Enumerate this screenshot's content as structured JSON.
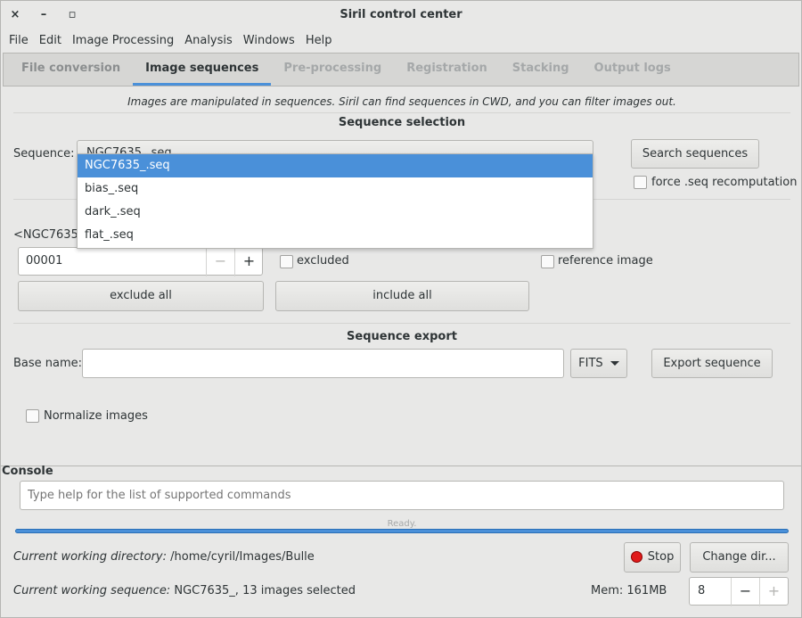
{
  "window": {
    "title": "Siril control center",
    "close_glyph": "×",
    "minimize_glyph": "–",
    "maximize_glyph": "▫"
  },
  "menu": [
    "File",
    "Edit",
    "Image Processing",
    "Analysis",
    "Windows",
    "Help"
  ],
  "tabs": [
    {
      "label": "File conversion",
      "state": "normal"
    },
    {
      "label": "Image sequences",
      "state": "active"
    },
    {
      "label": "Pre-processing",
      "state": "faded"
    },
    {
      "label": "Registration",
      "state": "faded"
    },
    {
      "label": "Stacking",
      "state": "faded"
    },
    {
      "label": "Output logs",
      "state": "faded"
    }
  ],
  "sequences_panel": {
    "info_text": "Images are manipulated in sequences. Siril can find sequences in CWD, and you can filter images out.",
    "selection_title": "Sequence selection",
    "sequence_label": "Sequence:",
    "sequence_value_partial": "NGC7635_.seq",
    "search_button": "Search sequences",
    "force_recompute_label": "force .seq recomputation",
    "dropdown_options": [
      "NGC7635_.seq",
      "bias_.seq",
      "dark_.seq",
      "flat_.seq"
    ],
    "selected_option_index": 0,
    "image_label_partial": "<NGC7635_",
    "image_number": "00001",
    "minus_glyph": "−",
    "plus_glyph": "+",
    "excluded_label": "excluded",
    "reference_label": "reference image",
    "exclude_all_button": "exclude all",
    "include_all_button": "include all",
    "export_title": "Sequence export",
    "base_name_label": "Base name:",
    "base_name_value": "",
    "format_value": "FITS",
    "export_button": "Export sequence",
    "normalize_label": "Normalize images"
  },
  "console": {
    "title": "Console",
    "command_placeholder": "Type help for the list of supported commands",
    "status_text": "Ready.",
    "progress": 1.0,
    "cwd_label": "Current working directory:",
    "cwd_value": "/home/cyril/Images/Bulle",
    "stop_button": "Stop",
    "change_dir_button": "Change dir...",
    "cws_label": "Current working sequence:",
    "cws_value": "NGC7635_, 13 images selected",
    "mem_text": "Mem: 161MB",
    "threads_value": "8"
  },
  "colors": {
    "accent": "#4a90d9",
    "stop_red": "#e01b1b"
  }
}
